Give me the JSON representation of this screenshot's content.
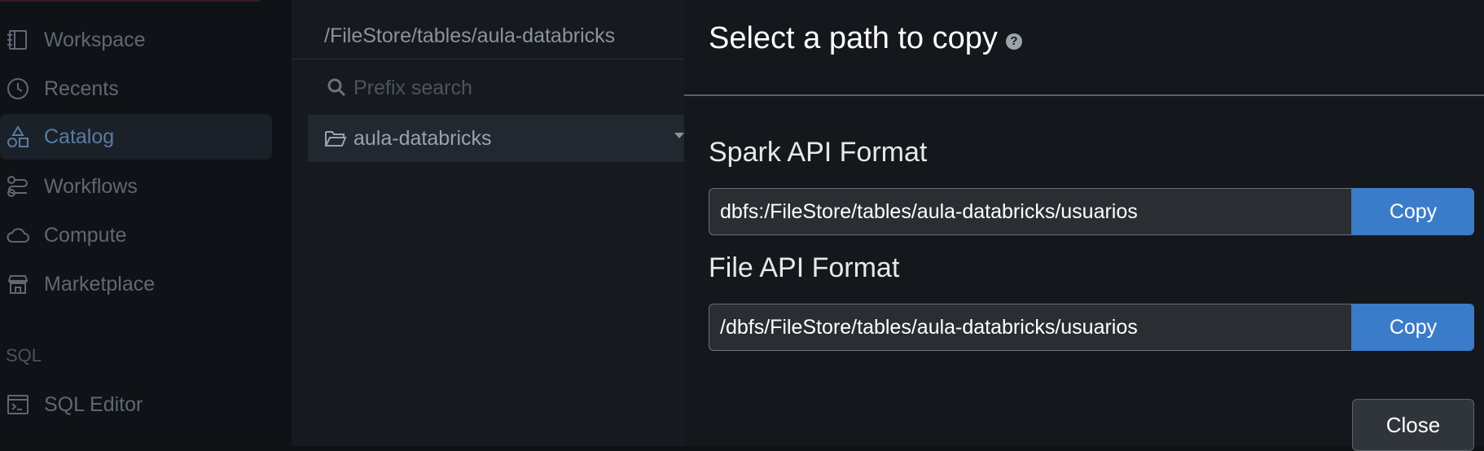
{
  "sidebar": {
    "items": [
      {
        "label": "Workspace",
        "icon": "workspace-icon"
      },
      {
        "label": "Recents",
        "icon": "clock-icon"
      },
      {
        "label": "Catalog",
        "icon": "catalog-icon",
        "active": true
      },
      {
        "label": "Workflows",
        "icon": "workflows-icon"
      },
      {
        "label": "Compute",
        "icon": "cloud-icon"
      },
      {
        "label": "Marketplace",
        "icon": "store-icon"
      }
    ],
    "section_sql": "SQL",
    "sql_items": [
      {
        "label": "SQL Editor",
        "icon": "sql-editor-icon"
      }
    ]
  },
  "browser": {
    "path": "/FileStore/tables/aula-databricks",
    "search_placeholder": "Prefix search",
    "folders": [
      {
        "name": "aula-databricks",
        "icon": "folder-open-icon"
      }
    ]
  },
  "modal": {
    "title": "Select a path to copy",
    "help_icon": "?",
    "spark_label": "Spark API Format",
    "spark_path": "dbfs:/FileStore/tables/aula-databricks/usuarios",
    "file_label": "File API Format",
    "file_path": "/dbfs/FileStore/tables/aula-databricks/usuarios",
    "copy_label": "Copy",
    "close_label": "Close"
  },
  "colors": {
    "accent": "#3a7cc9",
    "active_nav": "#5a7ca0"
  }
}
